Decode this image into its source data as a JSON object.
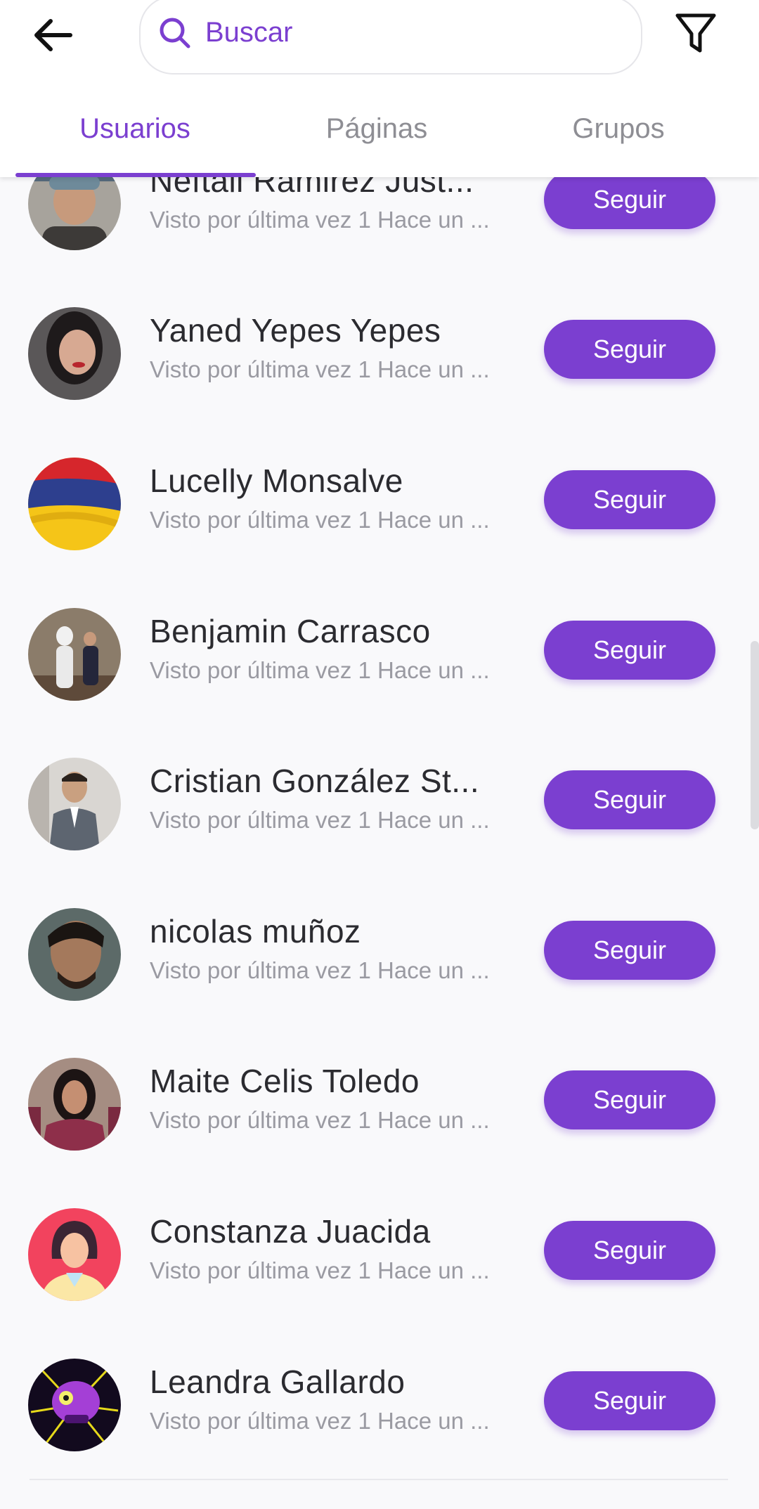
{
  "search": {
    "placeholder": "Buscar",
    "value": ""
  },
  "header": {
    "back_icon": "arrow-left-icon",
    "filter_icon": "funnel-icon"
  },
  "tabs": [
    {
      "label": "Usuarios",
      "active": true
    },
    {
      "label": "Páginas",
      "active": false
    },
    {
      "label": "Grupos",
      "active": false
    }
  ],
  "accent_color": "#7b3fd0",
  "users": [
    {
      "name": "Neftali Ramirez Just...",
      "status": "Visto por última vez 1 Hace un ...",
      "button": "Seguir"
    },
    {
      "name": "Yaned Yepes Yepes",
      "status": "Visto por última vez 1 Hace un ...",
      "button": "Seguir"
    },
    {
      "name": "Lucelly Monsalve",
      "status": "Visto por última vez 1 Hace un ...",
      "button": "Seguir"
    },
    {
      "name": "Benjamin Carrasco",
      "status": "Visto por última vez 1 Hace un ...",
      "button": "Seguir"
    },
    {
      "name": "Cristian González St...",
      "status": "Visto por última vez 1 Hace un ...",
      "button": "Seguir"
    },
    {
      "name": "nicolas muñoz",
      "status": "Visto por última vez 1 Hace un ...",
      "button": "Seguir"
    },
    {
      "name": "Maite Celis Toledo",
      "status": "Visto por última vez 1 Hace un ...",
      "button": "Seguir"
    },
    {
      "name": "Constanza Juacida",
      "status": "Visto por última vez 1 Hace un ...",
      "button": "Seguir"
    },
    {
      "name": "Leandra Gallardo",
      "status": "Visto por última vez 1 Hace un ...",
      "button": "Seguir"
    }
  ]
}
